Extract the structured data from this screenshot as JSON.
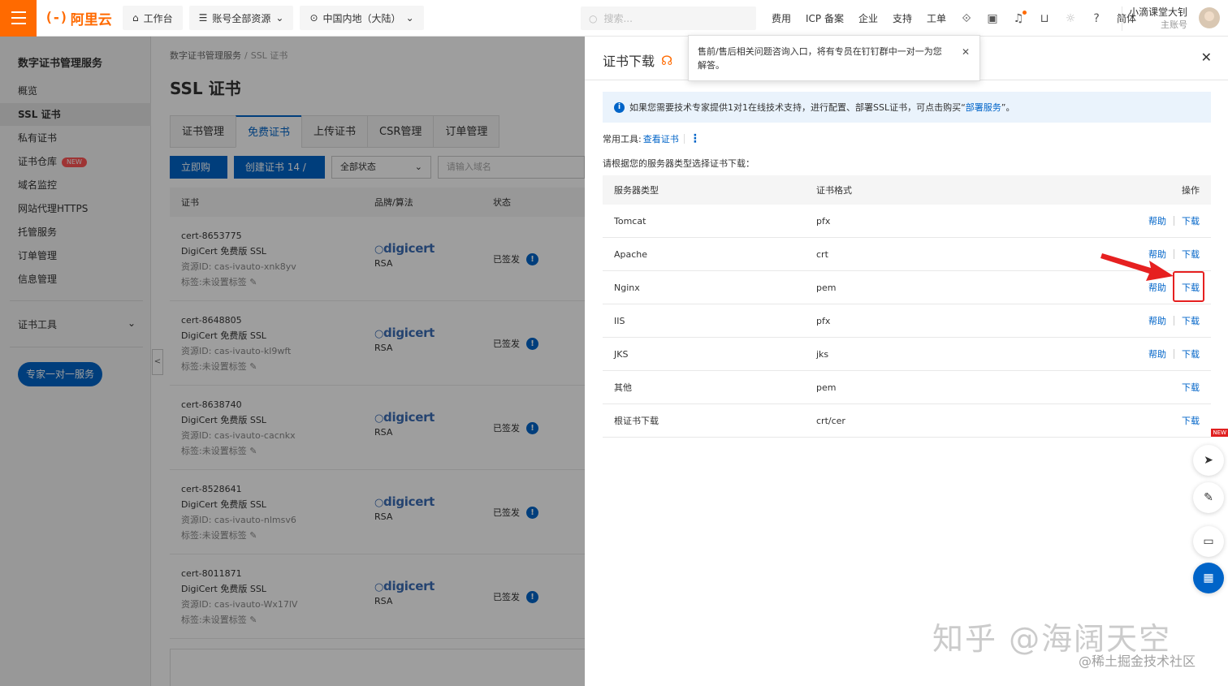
{
  "topbar": {
    "logo_text": "阿里云",
    "workbench": "工作台",
    "resources": "账号全部资源",
    "region": "中国内地（大陆）",
    "search_placeholder": "搜索...",
    "links": [
      "费用",
      "ICP 备案",
      "企业",
      "支持",
      "工单"
    ],
    "lang": "简体",
    "user_name": "小滴课堂大钊",
    "user_role": "主账号"
  },
  "sidebar": {
    "title": "数字证书管理服务",
    "items": [
      {
        "label": "概览"
      },
      {
        "label": "SSL 证书"
      },
      {
        "label": "私有证书"
      },
      {
        "label": "证书仓库",
        "badge": "NEW"
      },
      {
        "label": "域名监控"
      },
      {
        "label": "网站代理HTTPS"
      },
      {
        "label": "托管服务"
      },
      {
        "label": "订单管理"
      },
      {
        "label": "信息管理"
      }
    ],
    "tools_label": "证书工具",
    "expert_button": "专家一对一服务"
  },
  "main": {
    "breadcrumb": [
      "数字证书管理服务",
      "SSL 证书"
    ],
    "title": "SSL 证书",
    "tabs": [
      "证书管理",
      "免费证书",
      "上传证书",
      "CSR管理",
      "订单管理"
    ],
    "buy_button": "立即购买",
    "create_button": "创建证书 14 / 20",
    "status_select": "全部状态",
    "domain_placeholder": "请输入域名",
    "columns": [
      "证书",
      "品牌/算法",
      "状态"
    ],
    "rows": [
      {
        "id": "cert-8653775",
        "product": "DigiCert 免费版 SSL",
        "resource": "资源ID: cas-ivauto-xnk8yv",
        "tag": "标签:未设置标签",
        "brand": "digicert",
        "algo": "RSA",
        "status": "已签发"
      },
      {
        "id": "cert-8648805",
        "product": "DigiCert 免费版 SSL",
        "resource": "资源ID: cas-ivauto-kl9wft",
        "tag": "标签:未设置标签",
        "brand": "digicert",
        "algo": "RSA",
        "status": "已签发"
      },
      {
        "id": "cert-8638740",
        "product": "DigiCert 免费版 SSL",
        "resource": "资源ID: cas-ivauto-cacnkx",
        "tag": "标签:未设置标签",
        "brand": "digicert",
        "algo": "RSA",
        "status": "已签发"
      },
      {
        "id": "cert-8528641",
        "product": "DigiCert 免费版 SSL",
        "resource": "资源ID: cas-ivauto-nlmsv6",
        "tag": "标签:未设置标签",
        "brand": "digicert",
        "algo": "RSA",
        "status": "已签发"
      },
      {
        "id": "cert-8011871",
        "product": "DigiCert 免费版 SSL",
        "resource": "资源ID: cas-ivauto-Wx17lV",
        "tag": "标签:未设置标签",
        "brand": "digicert",
        "algo": "RSA",
        "status": "已签发"
      }
    ]
  },
  "drawer": {
    "title": "证书下载",
    "tooltip": "售前/售后相关问题咨询入口，将有专员在钉钉群中一对一为您解答。",
    "notice_text": "如果您需要技术专家提供1对1在线技术支持，进行配置、部署SSL证书，可点击购买“",
    "notice_link": "部署服务",
    "notice_tail": "”。",
    "tools_label": "常用工具:",
    "tools_link": "查看证书",
    "choose_text": "请根据您的服务器类型选择证书下载：",
    "columns": [
      "服务器类型",
      "证书格式",
      "操作"
    ],
    "help_label": "帮助",
    "download_label": "下载",
    "rows": [
      {
        "type": "Tomcat",
        "format": "pfx"
      },
      {
        "type": "Apache",
        "format": "crt"
      },
      {
        "type": "Nginx",
        "format": "pem"
      },
      {
        "type": "IIS",
        "format": "pfx"
      },
      {
        "type": "JKS",
        "format": "jks"
      },
      {
        "type": "其他",
        "format": "pem"
      },
      {
        "type": "根证书下载",
        "format": "crt/cer"
      }
    ]
  },
  "floating": {
    "new_badge": "NEW"
  },
  "watermark": {
    "main": "知乎 @海阔天空",
    "sub": "@稀土掘金技术社区"
  },
  "colors": {
    "brand": "#ff6a00",
    "primary": "#0064c8",
    "highlight": "#e62020"
  }
}
